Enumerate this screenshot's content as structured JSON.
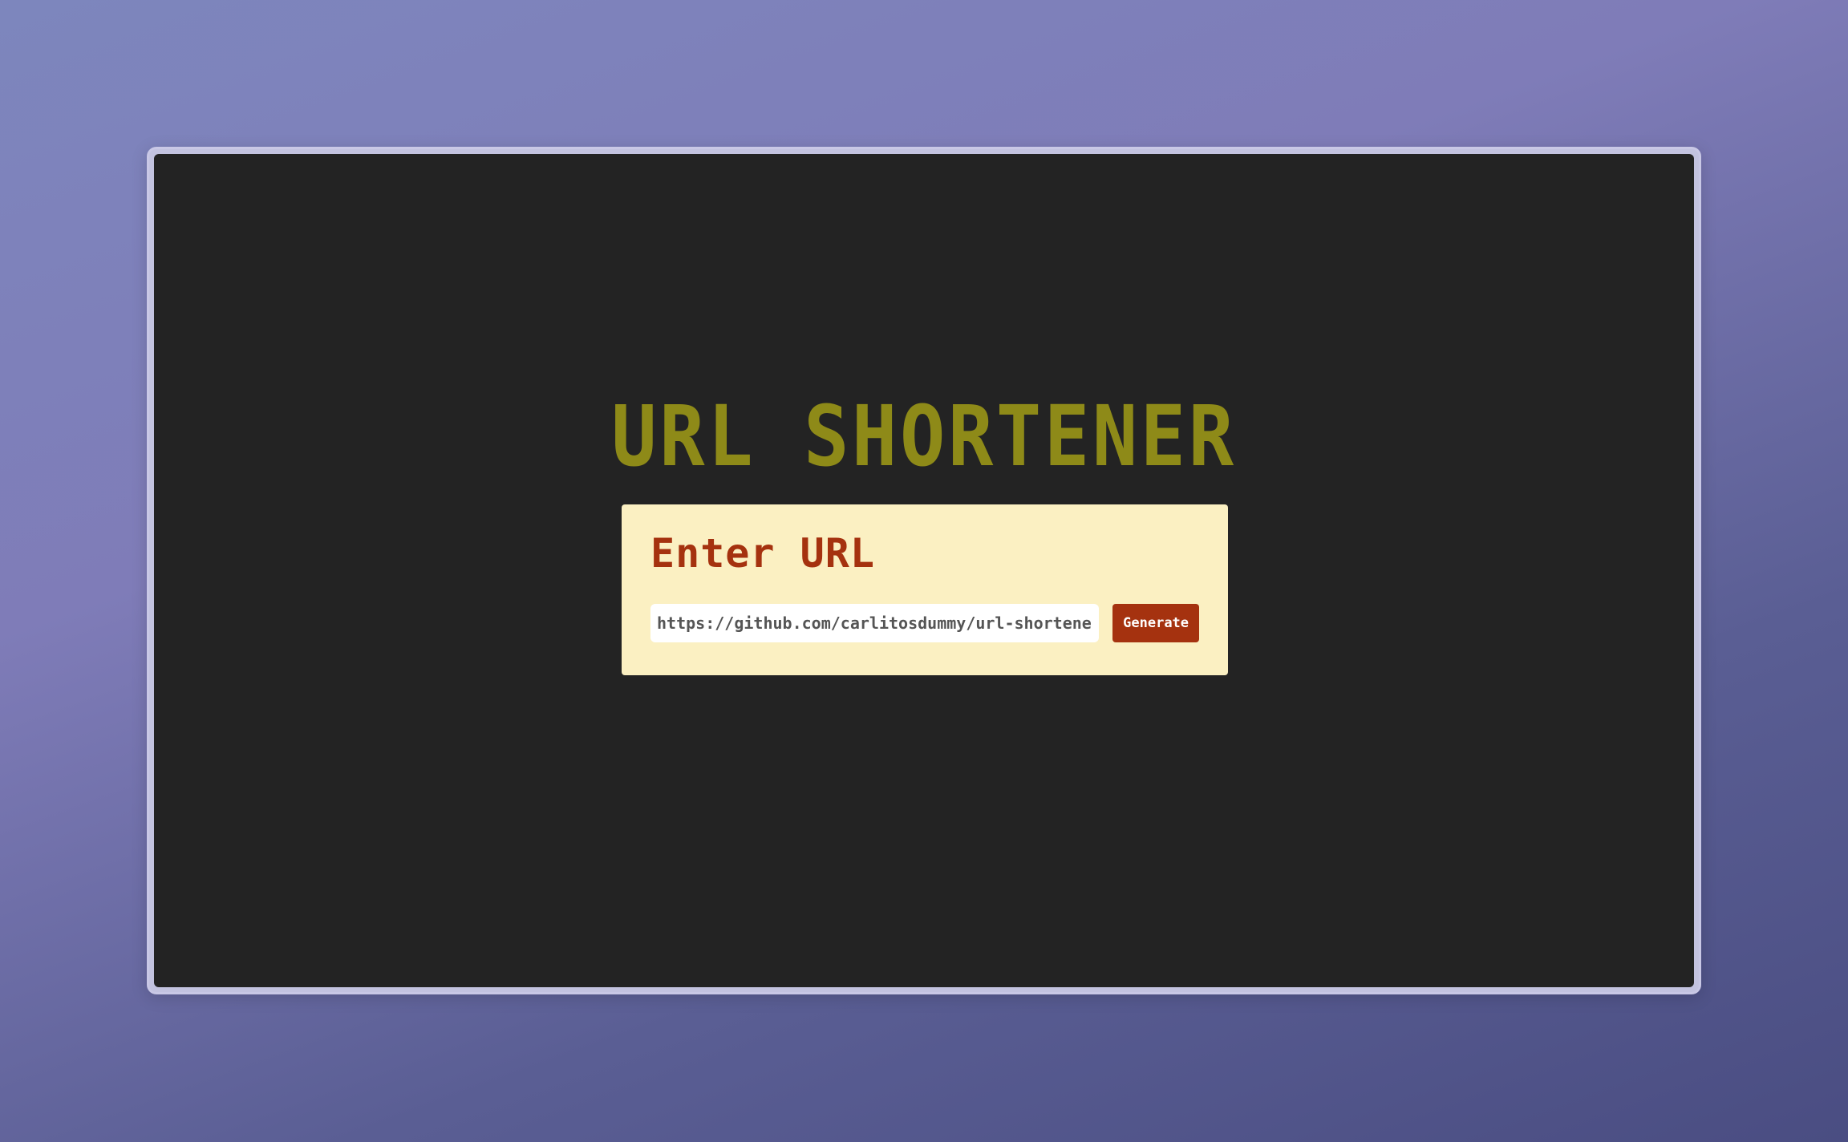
{
  "app": {
    "title": "URL SHORTENER"
  },
  "form": {
    "heading": "Enter URL",
    "url_value": "https://github.com/carlitosdummy/url-shortener",
    "generate_label": "Generate"
  },
  "colors": {
    "title": "#8e8a18",
    "screen_background": "#232323",
    "card_background": "#fbf0c2",
    "accent": "#a5320f"
  }
}
